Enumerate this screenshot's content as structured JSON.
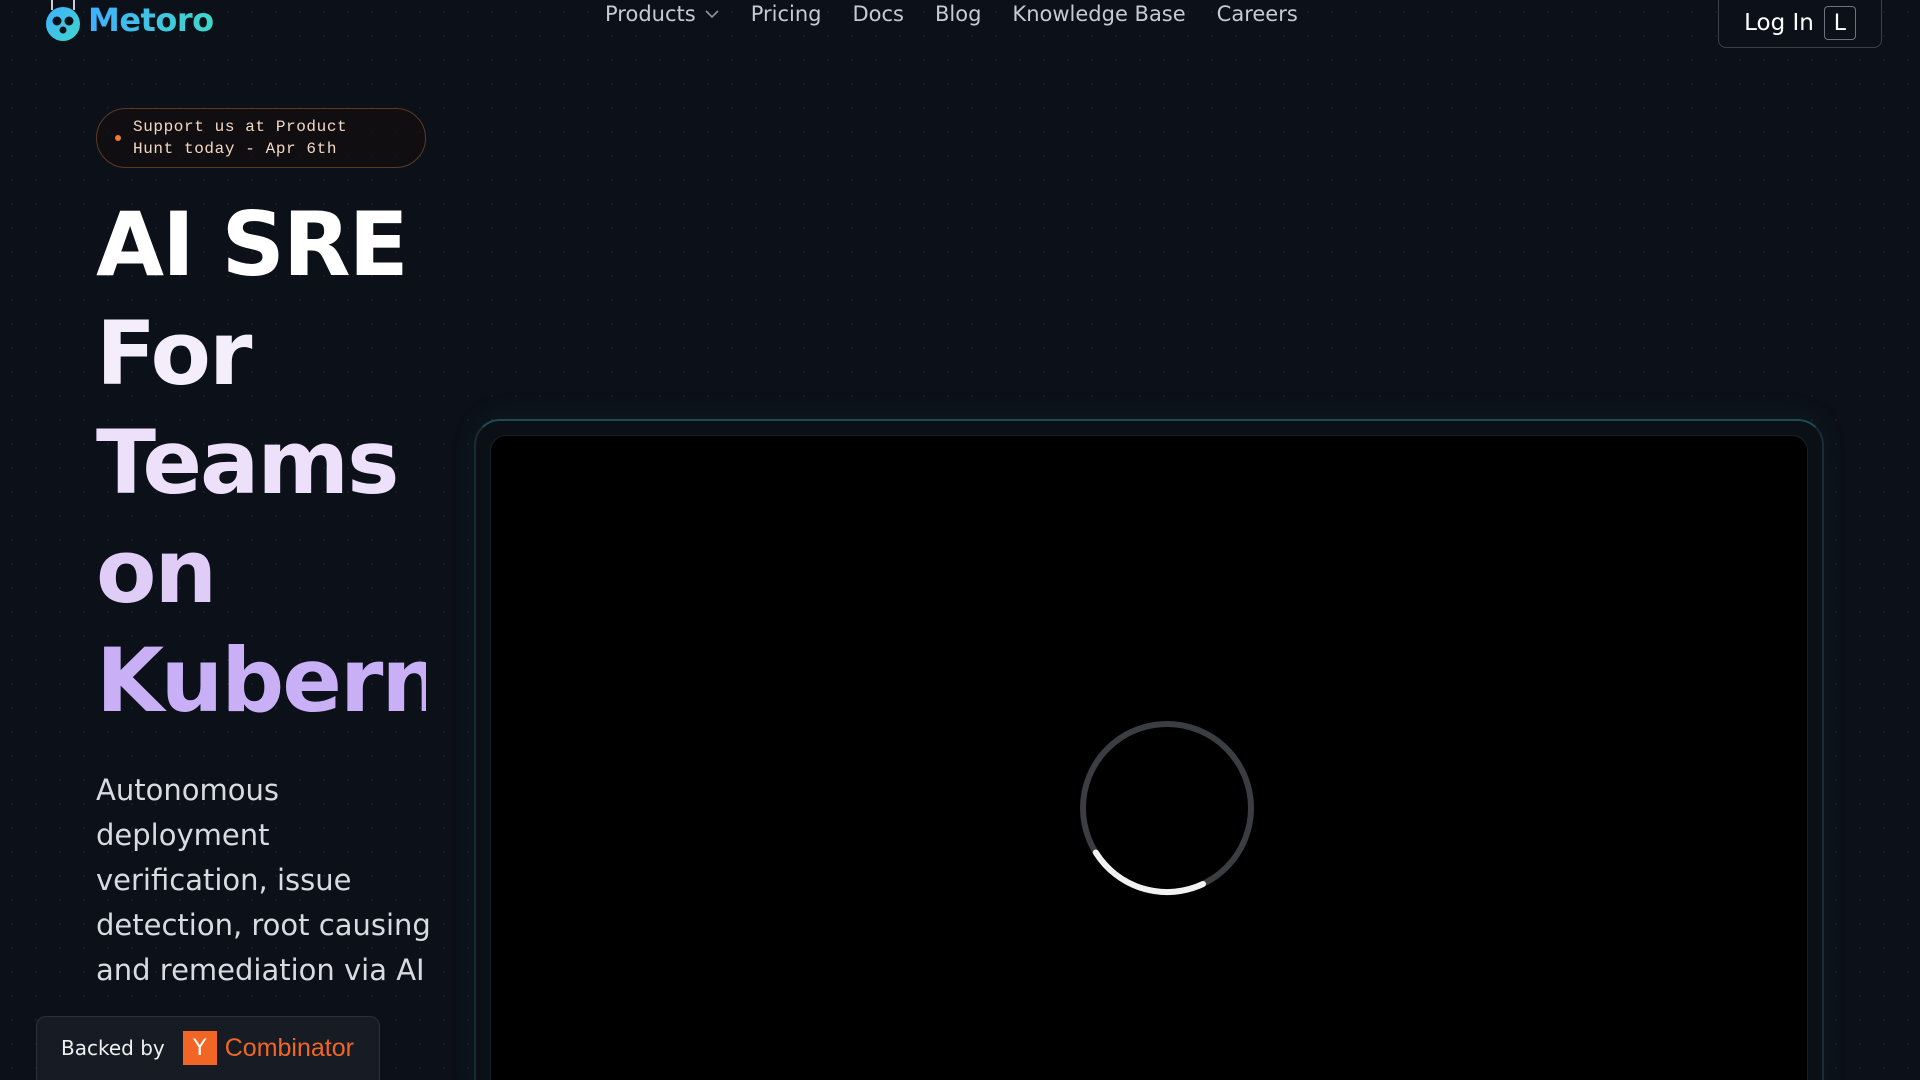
{
  "brand": {
    "name": "Metoro",
    "logo_icon": "metoro-logo-icon",
    "gradient": [
      "#3fb0ff",
      "#3fd7c9"
    ]
  },
  "nav": {
    "items": [
      {
        "label": "Products",
        "has_dropdown": true
      },
      {
        "label": "Pricing"
      },
      {
        "label": "Docs"
      },
      {
        "label": "Blog"
      },
      {
        "label": "Knowledge Base"
      },
      {
        "label": "Careers"
      }
    ],
    "login": {
      "label": "Log In",
      "shortcut": "L"
    }
  },
  "badge": {
    "text": "Support us at Product Hunt today - Apr 6th",
    "dot_color": "#f07a2f"
  },
  "hero": {
    "title_lines": [
      "AI SRE",
      "For",
      "Teams",
      "on",
      "Kubernetes"
    ],
    "subtitle": "Autonomous deployment verification, issue detection, root causing and remediation via AI"
  },
  "backed_by": {
    "label": "Backed by",
    "logo_letter": "Y",
    "logo_text": "Combinator",
    "color": "#f26625"
  },
  "video": {
    "state": "loading",
    "icon": "loading-spinner-icon"
  }
}
